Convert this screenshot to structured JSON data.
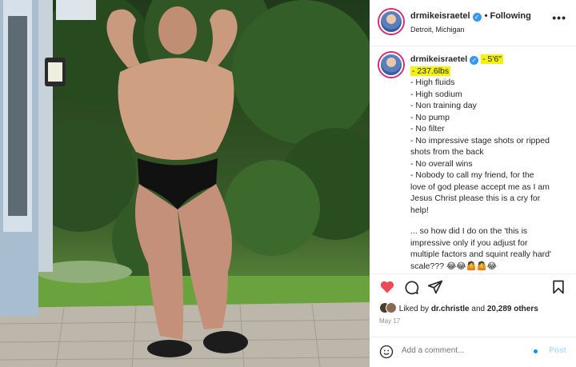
{
  "post": {
    "username": "drmikeisraetel",
    "verified": true,
    "follow_status": "Following",
    "separator": "•",
    "location": "Detroit, Michigan",
    "more_icon": "more-horizontal-icon"
  },
  "caption": {
    "username": "drmikeisraetel",
    "height_highlight": "- 5'6\"",
    "weight_highlight": "- 237.6lbs",
    "lines": [
      "- High fluids",
      "- High sodium",
      "- Non training day",
      "- No pump",
      "- No filter",
      "- No impressive stage shots or ripped",
      "shots from the back",
      "- No overall wins",
      "- Nobody to call my friend, for the",
      "love of god please accept me as I am",
      "Jesus Christ please this is a cry for",
      "help!"
    ],
    "closing_lines": [
      "... so how did I do on the 'this is",
      "impressive only if you adjust for",
      "multiple factors and squint really hard'",
      "scale???"
    ],
    "emojis": "😂😂🤷🤷😂",
    "highlight_color": "#f4f10a"
  },
  "actions": {
    "like_icon": "heart-filled-icon",
    "comment_icon": "comment-icon",
    "share_icon": "send-icon",
    "save_icon": "bookmark-icon",
    "like_color": "#ed4956"
  },
  "likes": {
    "prefix": "Liked by",
    "friend": "dr.christle",
    "conjunction": "and",
    "others": "20,289 others"
  },
  "date": "May 17",
  "comment": {
    "placeholder": "Add a comment...",
    "post_label": "Post",
    "emoji_icon": "emoji-smile-icon"
  },
  "colors": {
    "verified_blue": "#3897f0",
    "post_button": "#b2dffc",
    "muted_text": "#8e8e8e"
  }
}
